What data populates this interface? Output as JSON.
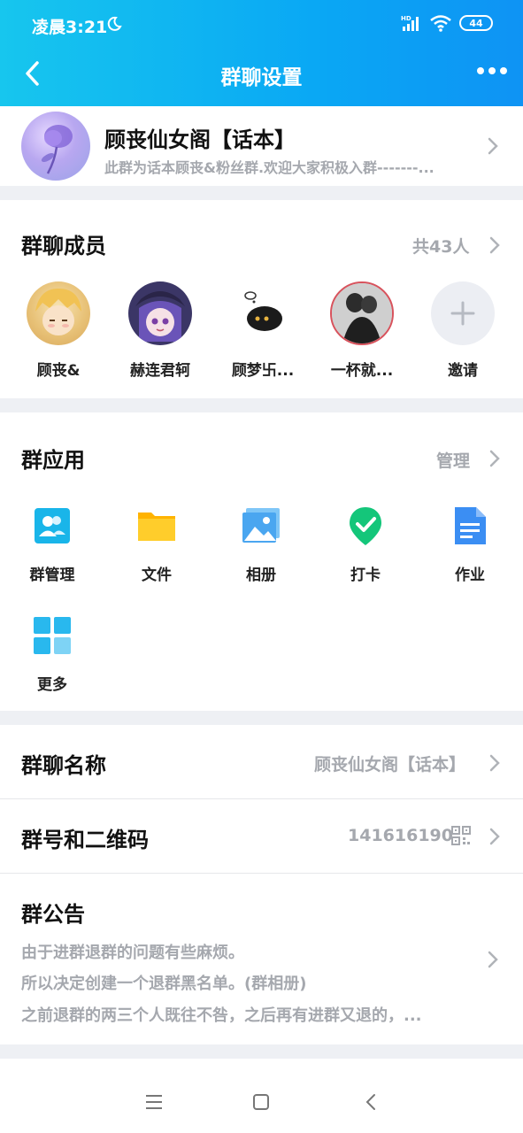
{
  "status": {
    "time": "凌晨3:21",
    "battery": "44",
    "signal_label": "HD"
  },
  "nav": {
    "title": "群聊设置"
  },
  "group": {
    "name": "顾丧仙女阁【话本】",
    "description": "此群为话本顾丧&粉丝群.欢迎大家积极入群-------..."
  },
  "members": {
    "title": "群聊成员",
    "count_label": "共43人",
    "list": [
      {
        "name": "顾丧&"
      },
      {
        "name": "赫连君轲"
      },
      {
        "name": "顾梦卐..."
      },
      {
        "name": "一杯就..."
      }
    ],
    "invite_label": "邀请"
  },
  "apps": {
    "title": "群应用",
    "manage_label": "管理",
    "items": [
      {
        "label": "群管理",
        "icon": "group-manage-icon"
      },
      {
        "label": "文件",
        "icon": "folder-icon"
      },
      {
        "label": "相册",
        "icon": "album-icon"
      },
      {
        "label": "打卡",
        "icon": "check-in-icon"
      },
      {
        "label": "作业",
        "icon": "homework-icon"
      },
      {
        "label": "更多",
        "icon": "more-apps-icon"
      }
    ]
  },
  "group_name_row": {
    "title": "群聊名称",
    "value": "顾丧仙女阁【话本】"
  },
  "group_id_row": {
    "title": "群号和二维码",
    "value": "141616190"
  },
  "notice": {
    "title": "群公告",
    "lines": [
      "由于进群退群的问题有些麻烦。",
      "所以决定创建一个退群黑名单。(群相册)",
      "之前退群的两三个人既往不咎，之后再有进群又退的，..."
    ]
  },
  "colors": {
    "header_start": "#17c6ee",
    "header_end": "#0e93f4",
    "accent": "#12b7f5"
  }
}
